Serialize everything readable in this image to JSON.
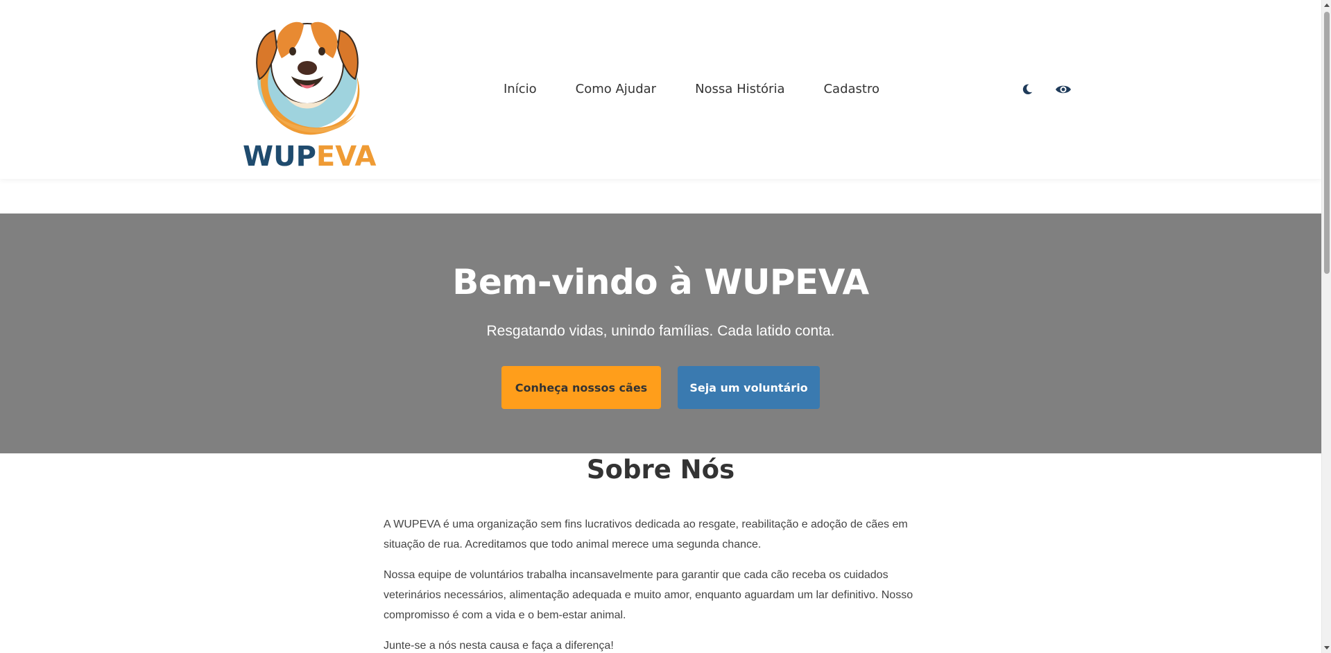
{
  "header": {
    "logo": {
      "text_part1": "WUP",
      "text_part2": "EVA",
      "icon": "dog-logo-icon"
    },
    "nav": [
      {
        "label": "Início"
      },
      {
        "label": "Como Ajudar"
      },
      {
        "label": "Nossa História"
      },
      {
        "label": "Cadastro"
      }
    ],
    "tools": [
      {
        "icon": "moon-icon"
      },
      {
        "icon": "eye-icon"
      }
    ]
  },
  "hero": {
    "title": "Bem-vindo à WUPEVA",
    "subtitle": "Resgatando vidas, unindo famílias. Cada latido conta.",
    "primary_button": "Conheça nossos cães",
    "secondary_button": "Seja um voluntário"
  },
  "about": {
    "title": "Sobre Nós",
    "paragraphs": [
      "A WUPEVA é uma organização sem fins lucrativos dedicada ao resgate, reabilitação e adoção de cães em situação de rua. Acreditamos que todo animal merece uma segunda chance.",
      "Nossa equipe de voluntários trabalha incansavelmente para garantir que cada cão receba os cuidados veterinários necessários, alimentação adequada e muito amor, enquanto aguardam um lar definitivo. Nosso compromisso é com a vida e o bem-estar animal.",
      "Junte-se a nós nesta causa e faça a diferença!"
    ]
  },
  "colors": {
    "brand_blue": "#1f4b6e",
    "brand_orange": "#ef9b34",
    "hero_bg": "#808080",
    "primary_button": "#ff9e1b",
    "secondary_button": "#3a7ab0"
  }
}
